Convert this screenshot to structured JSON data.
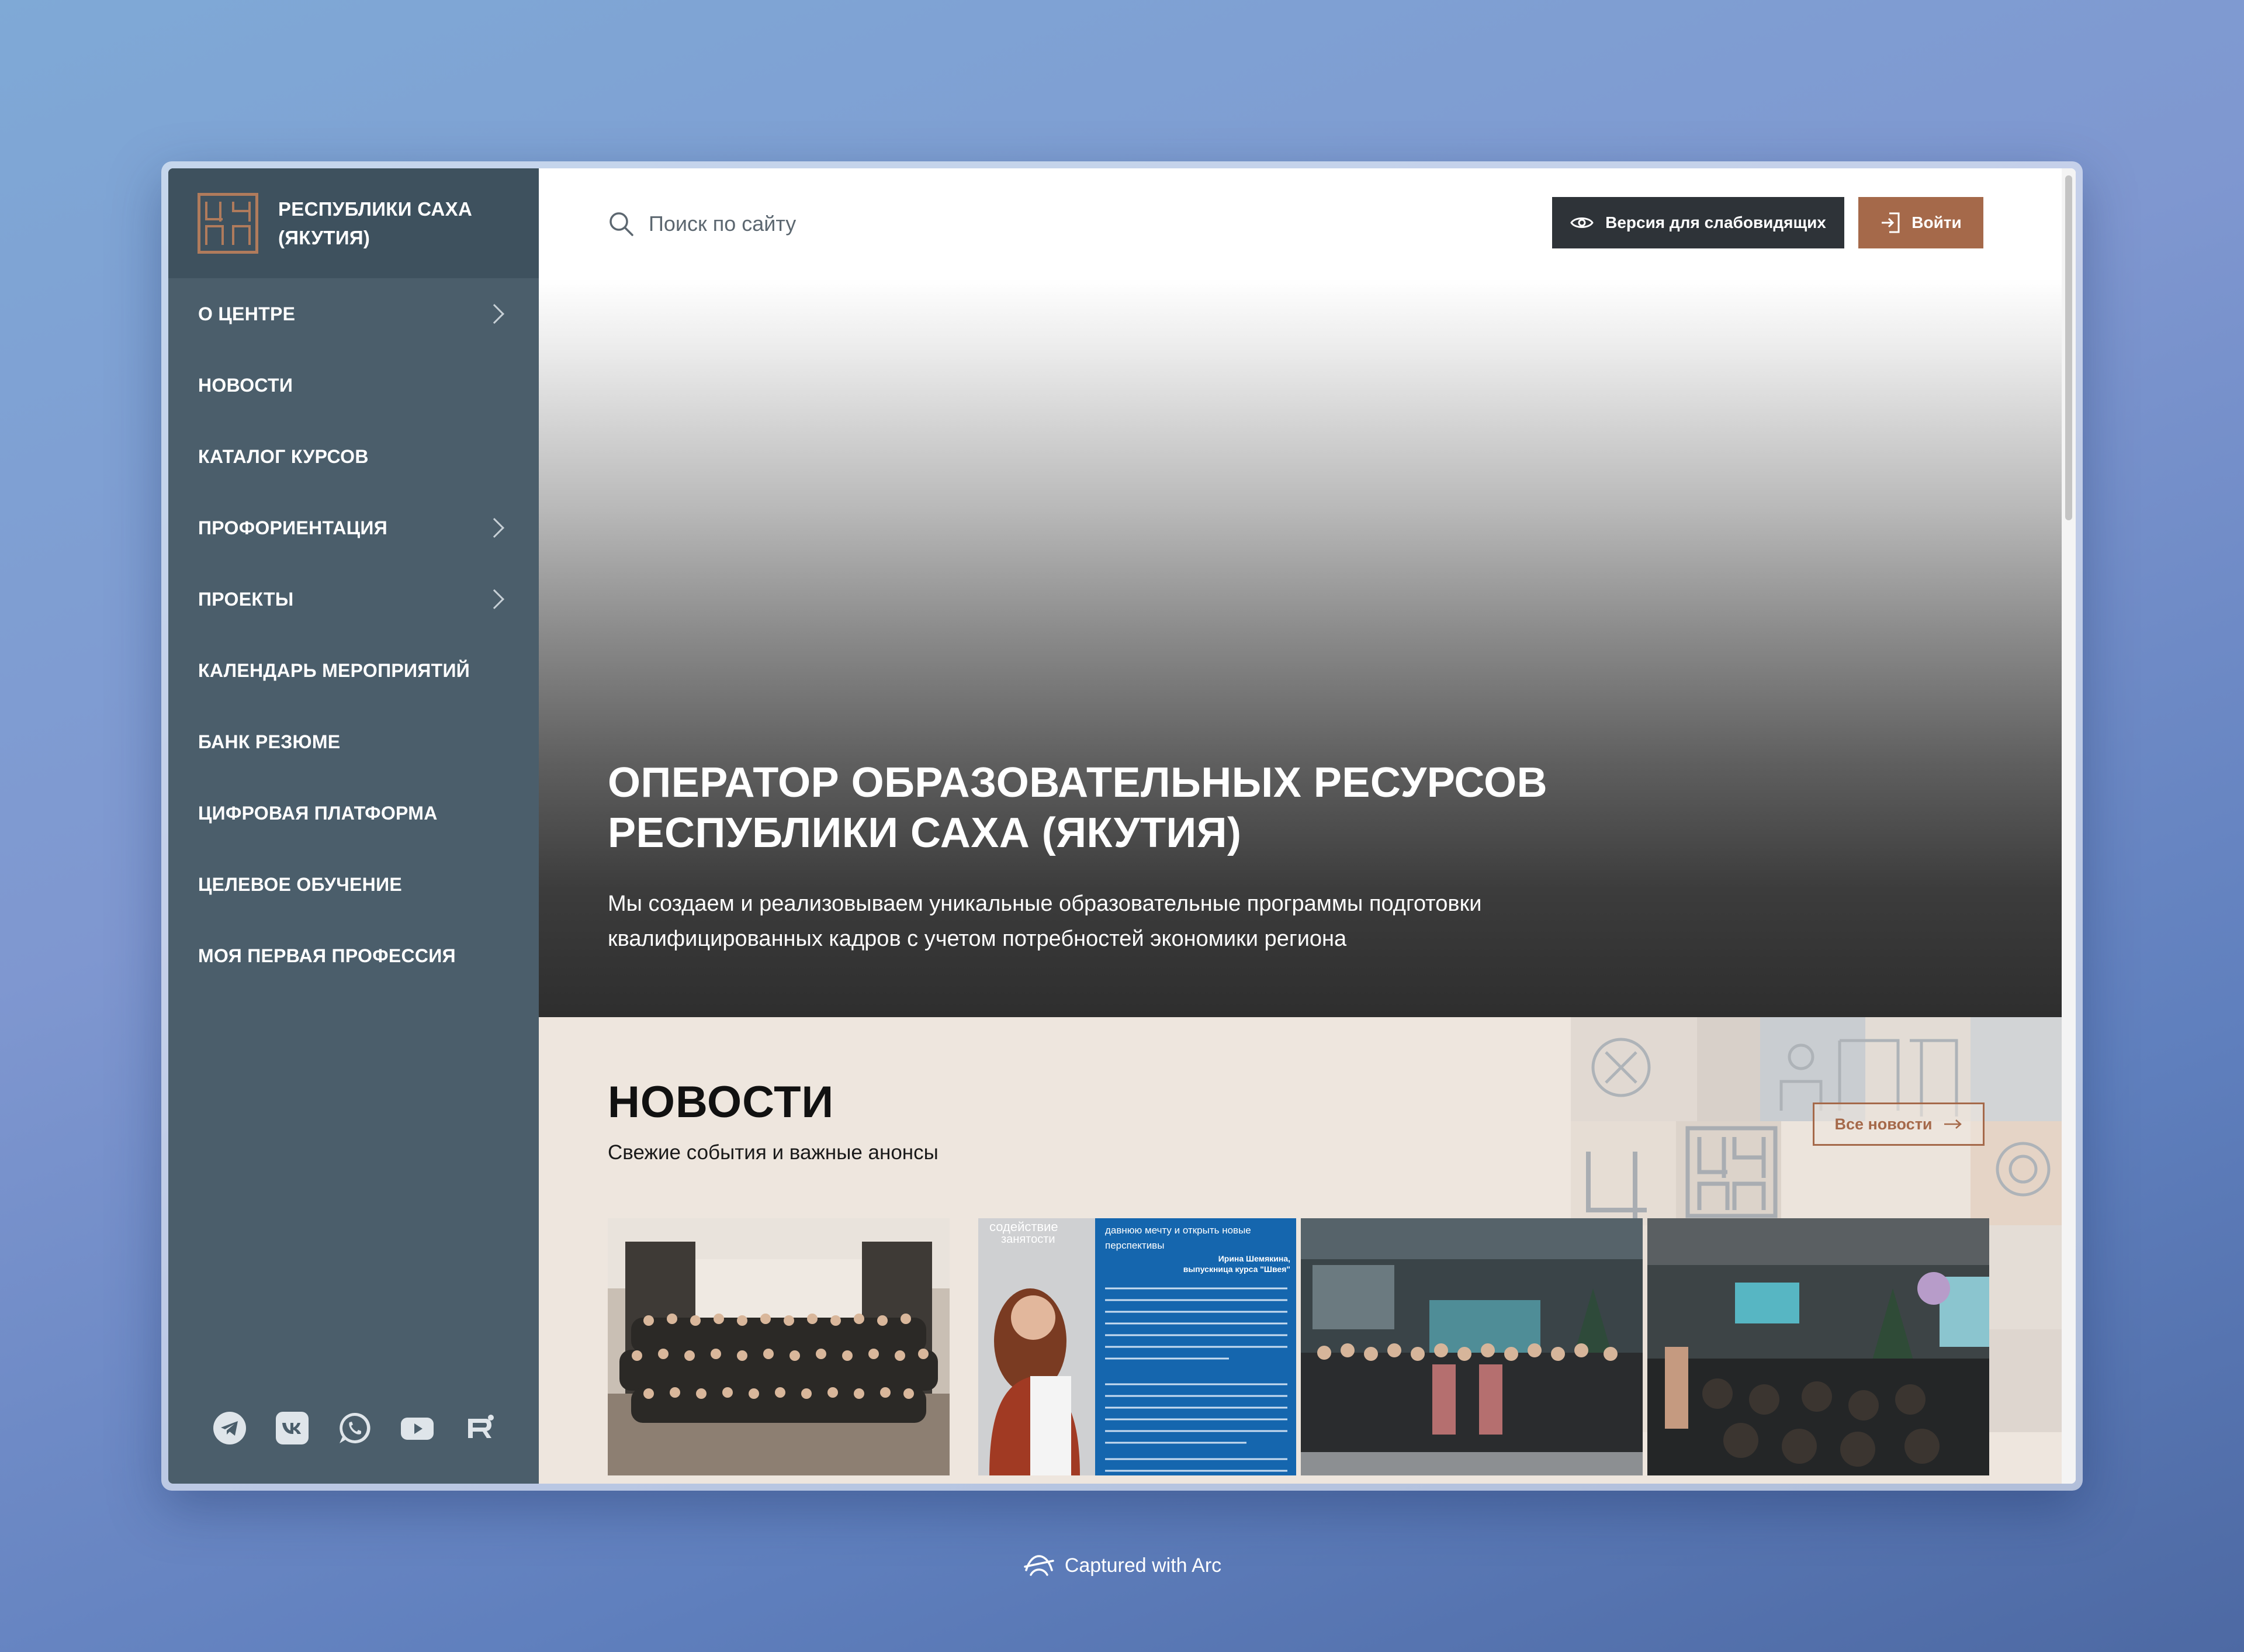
{
  "brand": {
    "name_line1": "РЕСПУБЛИКИ САХА",
    "name_line2": "(ЯКУТИЯ)",
    "accent_color": "#b07b5c"
  },
  "sidebar": {
    "items": [
      {
        "label": "О ЦЕНТРЕ",
        "has_submenu": true
      },
      {
        "label": "НОВОСТИ",
        "has_submenu": false
      },
      {
        "label": "КАТАЛОГ КУРСОВ",
        "has_submenu": false
      },
      {
        "label": "ПРОФОРИЕНТАЦИЯ",
        "has_submenu": true
      },
      {
        "label": "ПРОЕКТЫ",
        "has_submenu": true
      },
      {
        "label": "КАЛЕНДАРЬ МЕРОПРИЯТИЙ",
        "has_submenu": false
      },
      {
        "label": "БАНК РЕЗЮМЕ",
        "has_submenu": false
      },
      {
        "label": "ЦИФРОВАЯ ПЛАТФОРМА",
        "has_submenu": false
      },
      {
        "label": "ЦЕЛЕВОЕ ОБУЧЕНИЕ",
        "has_submenu": false
      },
      {
        "label": "МОЯ ПЕРВАЯ ПРОФЕССИЯ",
        "has_submenu": false
      }
    ],
    "socials": [
      "telegram-icon",
      "vk-icon",
      "whatsapp-icon",
      "youtube-icon",
      "rutube-icon"
    ]
  },
  "header": {
    "search_placeholder": "Поиск по сайту",
    "vision_button": "Версия для слабовидящих",
    "login_button": "Войти"
  },
  "hero": {
    "title_line1": "ОПЕРАТОР ОБРАЗОВАТЕЛЬНЫХ РЕСУРСОВ",
    "title_line2": "РЕСПУБЛИКИ САХА (ЯКУТИЯ)",
    "subtitle_line1": "Мы создаем и реализовываем уникальные образовательные программы подготовки",
    "subtitle_line2": "квалифицированных кадров с учетом потребностей экономики региона"
  },
  "news": {
    "title": "НОВОСТИ",
    "subtitle": "Свежие события и важные анонсы",
    "all_button": "Все новости",
    "card2": {
      "badge_line1": "содействие",
      "badge_line2": "занятости",
      "quote_line1": "давнюю мечту и открыть новые",
      "quote_line2": "перспективы",
      "author_line1": "Ирина Шемякина,",
      "author_line2": "выпускница курса \"Швея\""
    }
  },
  "footer_caption": "Captured with Arc",
  "colors": {
    "sidebar": "#4b5e6b",
    "brand_bar": "#3e515e",
    "accent": "#a5694a",
    "dark_button": "#2e3338",
    "news_bg": "#eee6de"
  }
}
